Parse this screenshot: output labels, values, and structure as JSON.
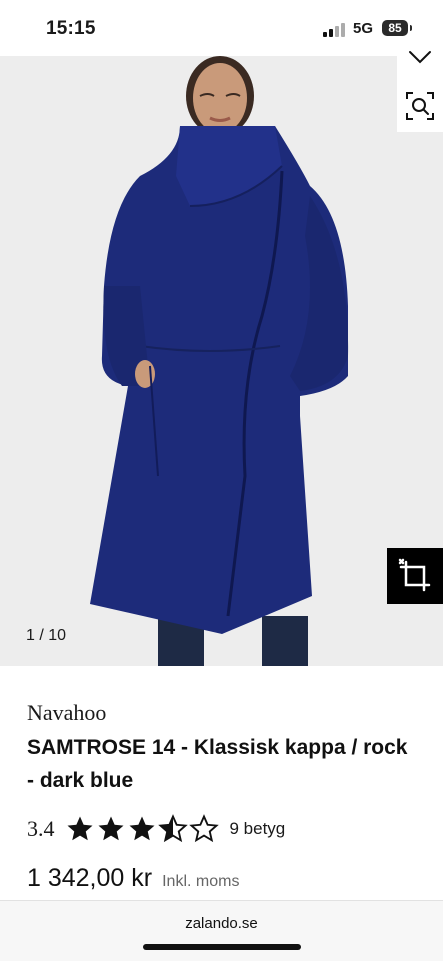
{
  "status_bar": {
    "time": "15:15",
    "network": "5G",
    "battery": "85",
    "icons": [
      "signal-icon",
      "battery-icon"
    ]
  },
  "gallery": {
    "counter": "1 / 10",
    "current_image": 1,
    "total_images": 10,
    "icons": [
      "heart-icon",
      "visual-search-icon",
      "crop-icon"
    ]
  },
  "product": {
    "brand": "Navahoo",
    "title": "SAMTROSE 14 - Klassisk kappa / rock - dark blue",
    "rating_value": "3.4",
    "rating_stars": 3.5,
    "rating_max": 5,
    "rating_count": "9 betyg",
    "price": "1 342,00 kr",
    "price_note": "Inkl. moms"
  },
  "browser": {
    "url": "zalando.se"
  },
  "colors": {
    "coat": "#1d2b7a",
    "background": "#ededed",
    "text": "#1a1a1a"
  }
}
